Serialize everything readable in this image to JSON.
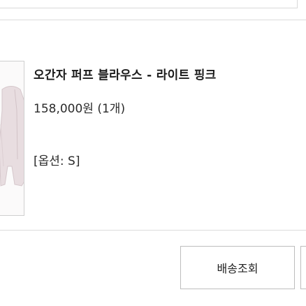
{
  "order_item": {
    "product_name": "오간자 퍼프 블라우스 - 라이트 핑크",
    "price": "158,000원",
    "quantity": "(1개)",
    "option": "[옵션: S]",
    "thumbnail_icon": "product-photo-blouse"
  },
  "actions": {
    "track_delivery_label": "배송조회"
  },
  "colors": {
    "product_tint": "#e6dadd",
    "border": "#d9d9d9",
    "text": "#222222"
  }
}
